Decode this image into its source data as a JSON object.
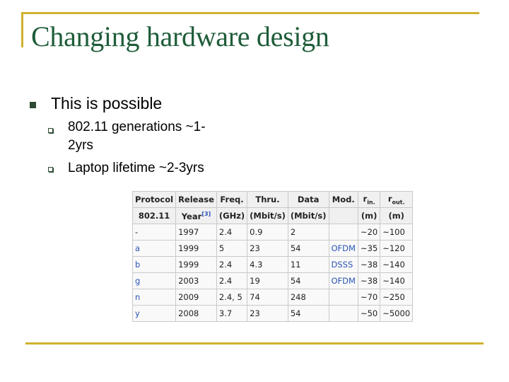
{
  "title": "Changing hardware design",
  "bullets": {
    "level1": "This is possible",
    "level2": [
      {
        "line1": "802.11 generations ~1-",
        "line2": "2yrs"
      },
      {
        "line1": "Laptop lifetime ~2-3yrs"
      }
    ]
  },
  "table": {
    "header_row1": [
      "Protocol",
      "Release",
      "Freq.",
      "Thru.",
      "Data",
      "Mod."
    ],
    "r_in": {
      "base": "r",
      "sub": "in."
    },
    "r_out": {
      "base": "r",
      "sub": "out."
    },
    "header_row2": [
      "802.11",
      "Year",
      "(GHz)",
      "(Mbit/s)",
      "(Mbit/s)",
      "",
      "(m)",
      "(m)"
    ],
    "year_ref": "[3]",
    "rows": [
      [
        "-",
        "1997",
        "2.4",
        "0.9",
        "2",
        "",
        "~20",
        "~100"
      ],
      [
        "a",
        "1999",
        "5",
        "23",
        "54",
        "OFDM",
        "~35",
        "~120"
      ],
      [
        "b",
        "1999",
        "2.4",
        "4.3",
        "11",
        "DSSS",
        "~38",
        "~140"
      ],
      [
        "g",
        "2003",
        "2.4",
        "19",
        "54",
        "OFDM",
        "~38",
        "~140"
      ],
      [
        "n",
        "2009",
        "2.4, 5",
        "74",
        "248",
        "",
        "~70",
        "~250"
      ],
      [
        "y",
        "2008",
        "3.7",
        "23",
        "54",
        "",
        "~50",
        "~5000"
      ]
    ]
  },
  "colors": {
    "title": "#1f5d3a",
    "frame": "#cfb22e",
    "link": "#2a55b4"
  }
}
